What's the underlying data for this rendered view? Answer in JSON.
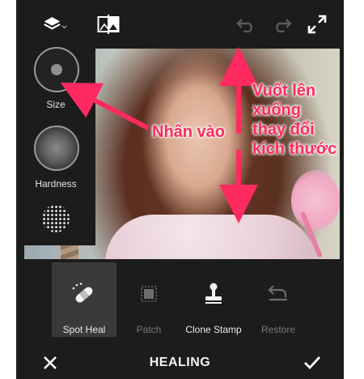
{
  "left_panel": {
    "size_label": "Size",
    "hardness_label": "Hardness"
  },
  "annotations": {
    "tap_hint": "Nhấn vào",
    "swipe_hint_lines": [
      "Vuốt lên",
      "xuống",
      "thay đổi",
      "kích thước"
    ]
  },
  "tools": [
    {
      "label": "Spot Heal",
      "state": "active"
    },
    {
      "label": "Patch",
      "state": "disabled"
    },
    {
      "label": "Clone Stamp",
      "state": "enabled"
    },
    {
      "label": "Restore",
      "state": "disabled"
    }
  ],
  "bottom_bar": {
    "mode_title": "HEALING"
  },
  "icons": {
    "layers": "layers-icon",
    "compare": "compare-icon",
    "undo": "undo-icon",
    "redo": "redo-icon",
    "fullscreen": "expand-icon",
    "cancel": "close-icon",
    "confirm": "check-icon"
  },
  "colors": {
    "annotation": "#ff2a5f",
    "background": "#1c1c1c",
    "active_tool_bg": "#3a3a3a"
  }
}
